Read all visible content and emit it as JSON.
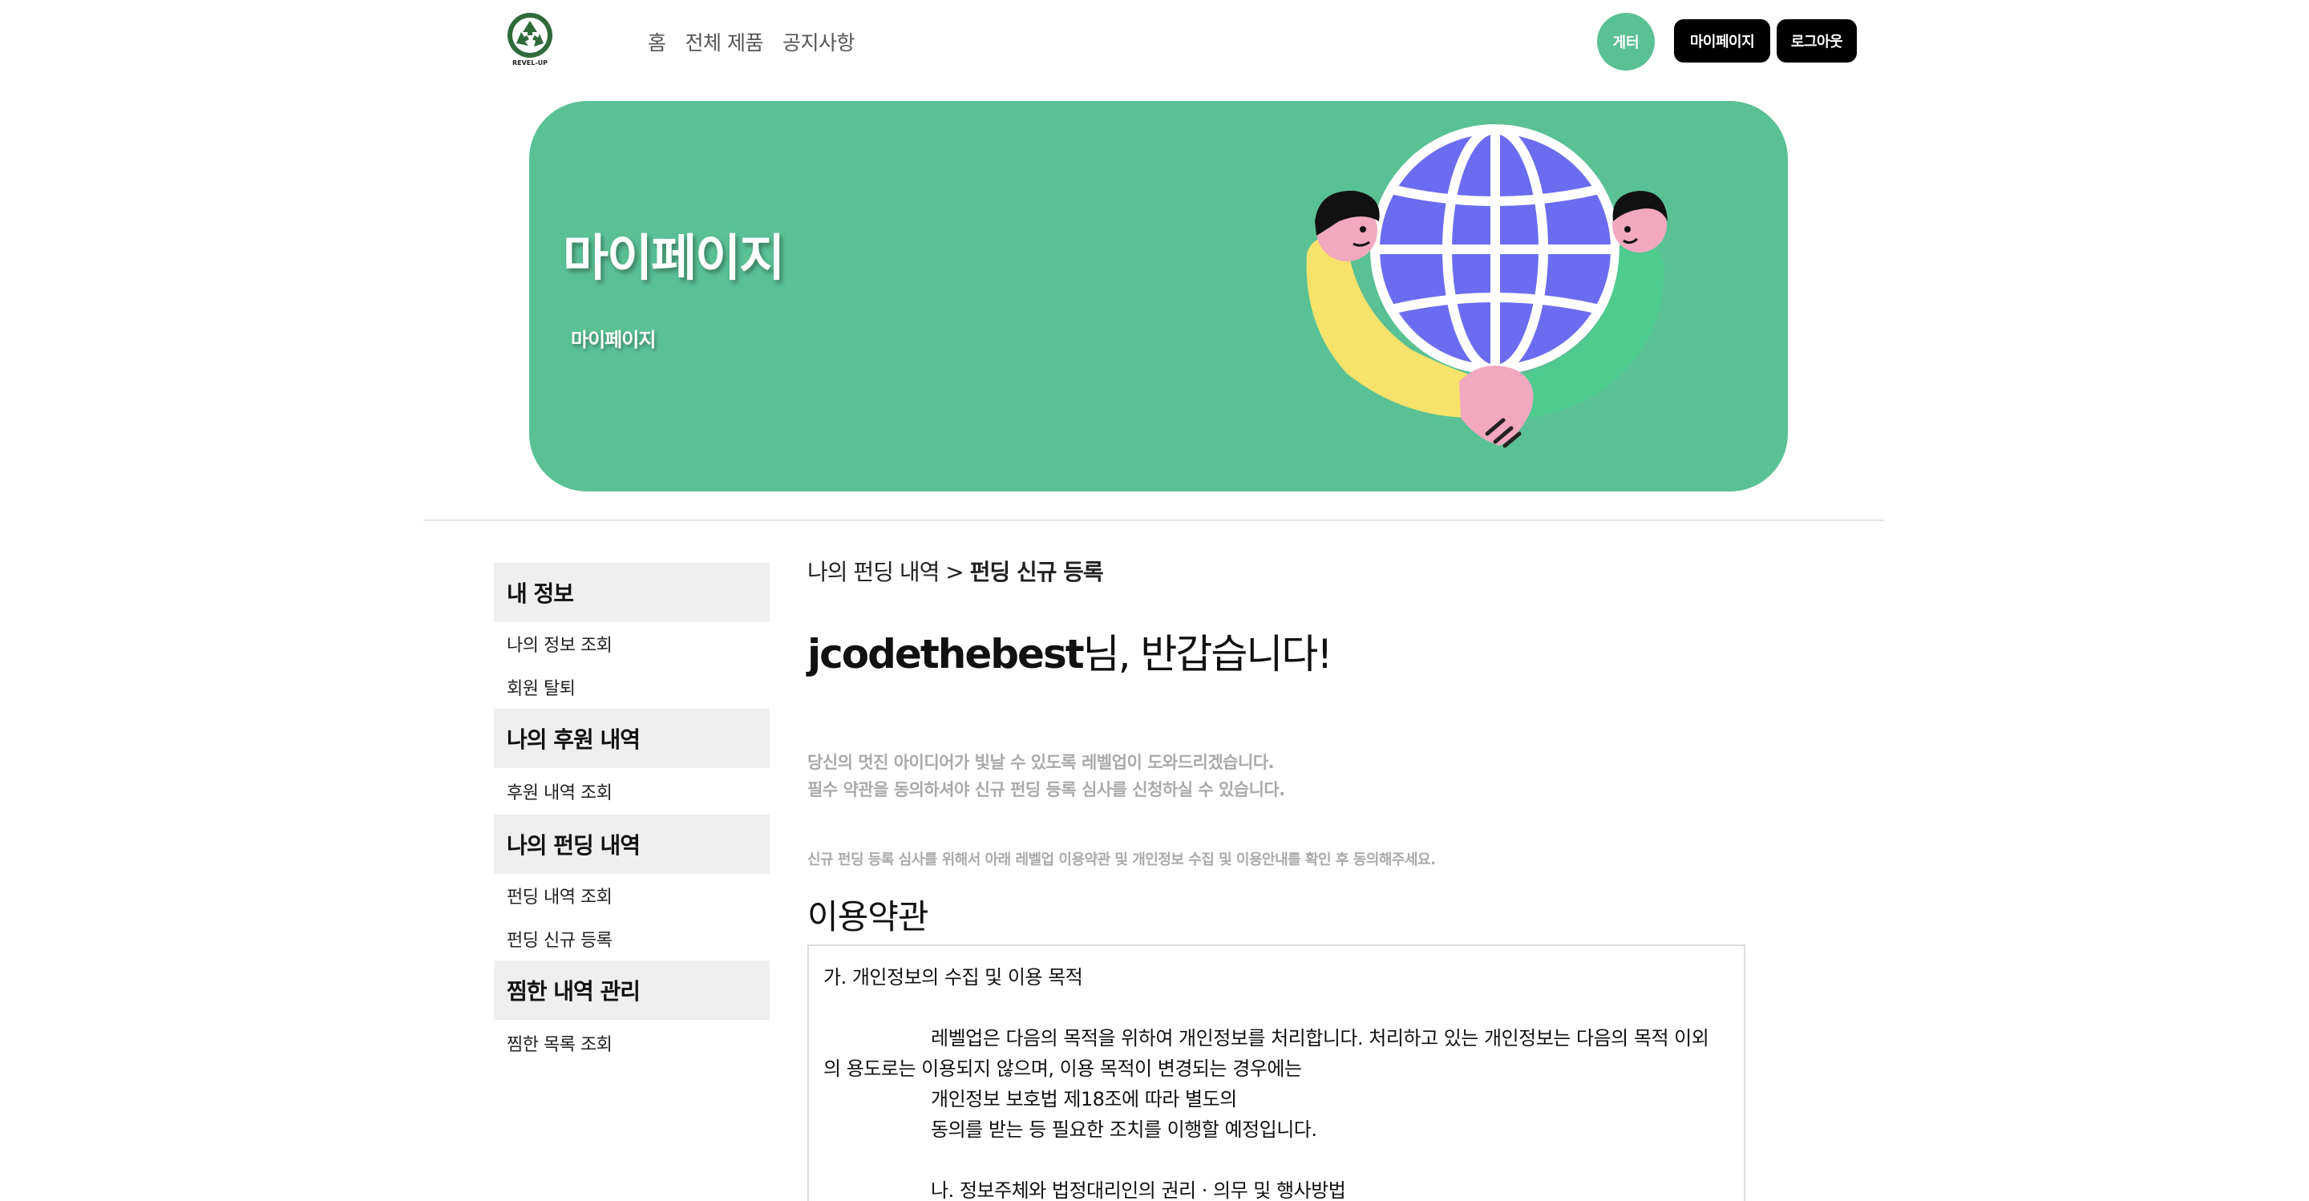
{
  "header": {
    "logo_text": "REVEL-UP",
    "nav": [
      {
        "label": "홈"
      },
      {
        "label": "전체 제품"
      },
      {
        "label": "공지사항"
      }
    ],
    "user_badge": "게터",
    "mypage_button": "마이페이지",
    "logout_button": "로그아웃"
  },
  "banner": {
    "title": "마이페이지",
    "subtitle": "마이페이지"
  },
  "sidebar": {
    "sections": [
      {
        "title": "내 정보",
        "items": [
          "나의 정보 조회",
          "회원 탈퇴"
        ]
      },
      {
        "title": "나의 후원 내역",
        "items": [
          "후원 내역 조회"
        ]
      },
      {
        "title": "나의 펀딩 내역",
        "items": [
          "펀딩 내역 조회",
          "펀딩 신규 등록"
        ]
      },
      {
        "title": "찜한 내역 관리",
        "items": [
          "찜한 목록 조회"
        ]
      }
    ]
  },
  "main": {
    "breadcrumb_parent": "나의 펀딩 내역 > ",
    "breadcrumb_current": "펀딩 신규 등록",
    "greeting_user": "jcodethebest",
    "greeting_suffix": "님, 반갑습니다!",
    "desc_line1": "당신의 멋진 아이디어가 빛날 수 있도록 레벨업이 도와드리겠습니다.",
    "desc_line2": "필수 약관을 동의하셔야 신규 펀딩 등록 심사를 신청하실 수 있습니다.",
    "note": "신규 펀딩 등록 심사를 위해서 아래 레벨업 이용약관 및 개인정보 수집 및 이용안내를 확인 후 동의해주세요.",
    "terms_title": "이용약관",
    "terms": {
      "heading_a": "가. 개인정보의 수집 및 이용 목적",
      "para_a1": "레벨업은 다음의 목적을 위하여 개인정보를 처리합니다. 처리하고 있는 개인정보는 다음의 목적 이외",
      "para_a2": "의 용도로는 이용되지 않으며, 이용 목적이 변경되는 경우에는",
      "para_a3": "개인정보 보호법 제18조에 따라 별도의",
      "para_a4": "동의를 받는 등 필요한 조치를 이행할 예정입니다.",
      "heading_b": "나. 정보주체와 법정대리인의 권리 · 의무 및 행사방법"
    }
  },
  "colors": {
    "brand_green": "#5ac195",
    "globe_blue": "#6b6cf0",
    "sidebar_bg": "#efefef"
  }
}
